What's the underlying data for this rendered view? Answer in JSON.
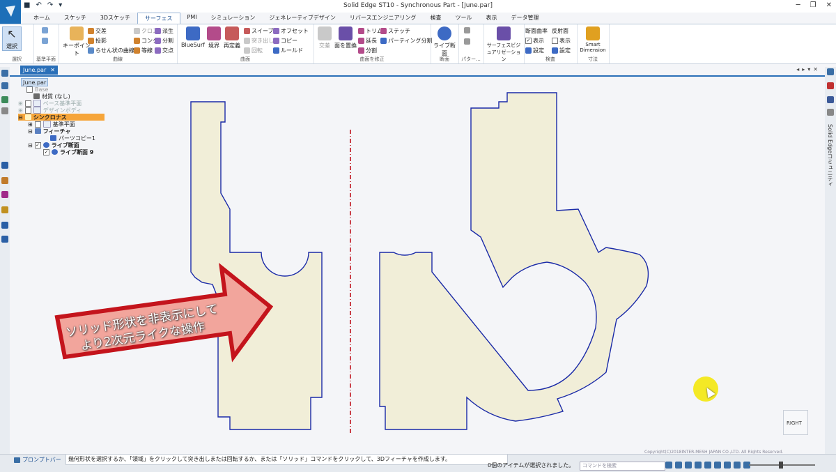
{
  "window": {
    "title": "Solid Edge ST10 - Synchronous Part - [June.par]"
  },
  "tabs": [
    "ホーム",
    "スケッチ",
    "3Dスケッチ",
    "サーフェス",
    "PMI",
    "シミュレーション",
    "ジェネレーティブデザイン",
    "リバースエンジニアリング",
    "検査",
    "ツール",
    "表示",
    "データ管理"
  ],
  "active_tab": "サーフェス",
  "ribbon": {
    "select": {
      "label": "選択",
      "group": "選択"
    },
    "plane_group": "基準平面",
    "curve": {
      "keypoint": "キーポイント",
      "intersect": "交差",
      "project": "投影",
      "helix": "らせん状の曲線",
      "cross": "クロス",
      "contour": "コンタ",
      "iso": "等線",
      "derive": "派生",
      "split": "分割",
      "intersection_pt": "交点",
      "group": "曲線"
    },
    "surface": {
      "bluesurf": "BlueSurf",
      "bounded": "境界",
      "redefine": "再定義",
      "sweep": "スイープ",
      "extrude": "突き出し",
      "revolve": "回転",
      "offset": "オフセット",
      "copy": "コピー",
      "ruled": "ルールド",
      "group": "曲面"
    },
    "modify": {
      "intersect": "交差",
      "replace": "面を置換",
      "trim": "トリム",
      "extend": "延長",
      "split": "分割",
      "stitch": "ステッチ",
      "parting_split": "パーティング分割",
      "group": "曲面を修正"
    },
    "section": {
      "live": "ライブ断面",
      "group": "断面"
    },
    "pattern": {
      "group": "パター..."
    },
    "viz": {
      "label": "サーフェスビジュアリゼーション"
    },
    "inspect": {
      "curvature": "断面曲率",
      "show": "表示",
      "settings": "設定",
      "reflect": "反射面",
      "show2": "表示",
      "settings2": "設定",
      "group": "検査"
    },
    "dim": {
      "label": "Smart Dimension",
      "group": "寸法"
    }
  },
  "document": {
    "tab": "June.par"
  },
  "tree": {
    "root": "June.par",
    "base": "Base",
    "material": "材質 (なし)",
    "base_planes": "ベース基準平面",
    "design_body": "デザインボディ",
    "synchronous": "シンクロナス",
    "ref_plane": "基準平面",
    "features": "フィーチャ",
    "part_copy": "パーツコピー1",
    "live_section": "ライブ断面",
    "live_section9": "ライブ断面 9"
  },
  "right_panel": {
    "label": "Solid Edgeコミュニティ"
  },
  "callout": {
    "line1": "ソリッド形状を非表示にして",
    "line2": "より2次元ライクな操作"
  },
  "nav_cube": {
    "label": "RIGHT"
  },
  "copyright": "Copyright(C)2018INTER-MESH JAPAN CO.,LTD. All Rights Reserved.",
  "status": {
    "prompt_label": "プロンプトバー",
    "message": "幾何形状を選択するか、「領域」をクリックして突き出しまたは回転するか、または「ソリッド」コマンドをクリックして、3Dフィーチャを作成します。",
    "selection": "0個のアイテムが選択されました。",
    "search_placeholder": "コマンドを検索"
  },
  "colors": {
    "accent": "#2a6fb8",
    "region_fill": "#f1eed8",
    "region_stroke": "#1a2aa8",
    "centerline": "#c0141e",
    "arrow": "#f2a59c",
    "arrow_stroke": "#c4141c"
  }
}
